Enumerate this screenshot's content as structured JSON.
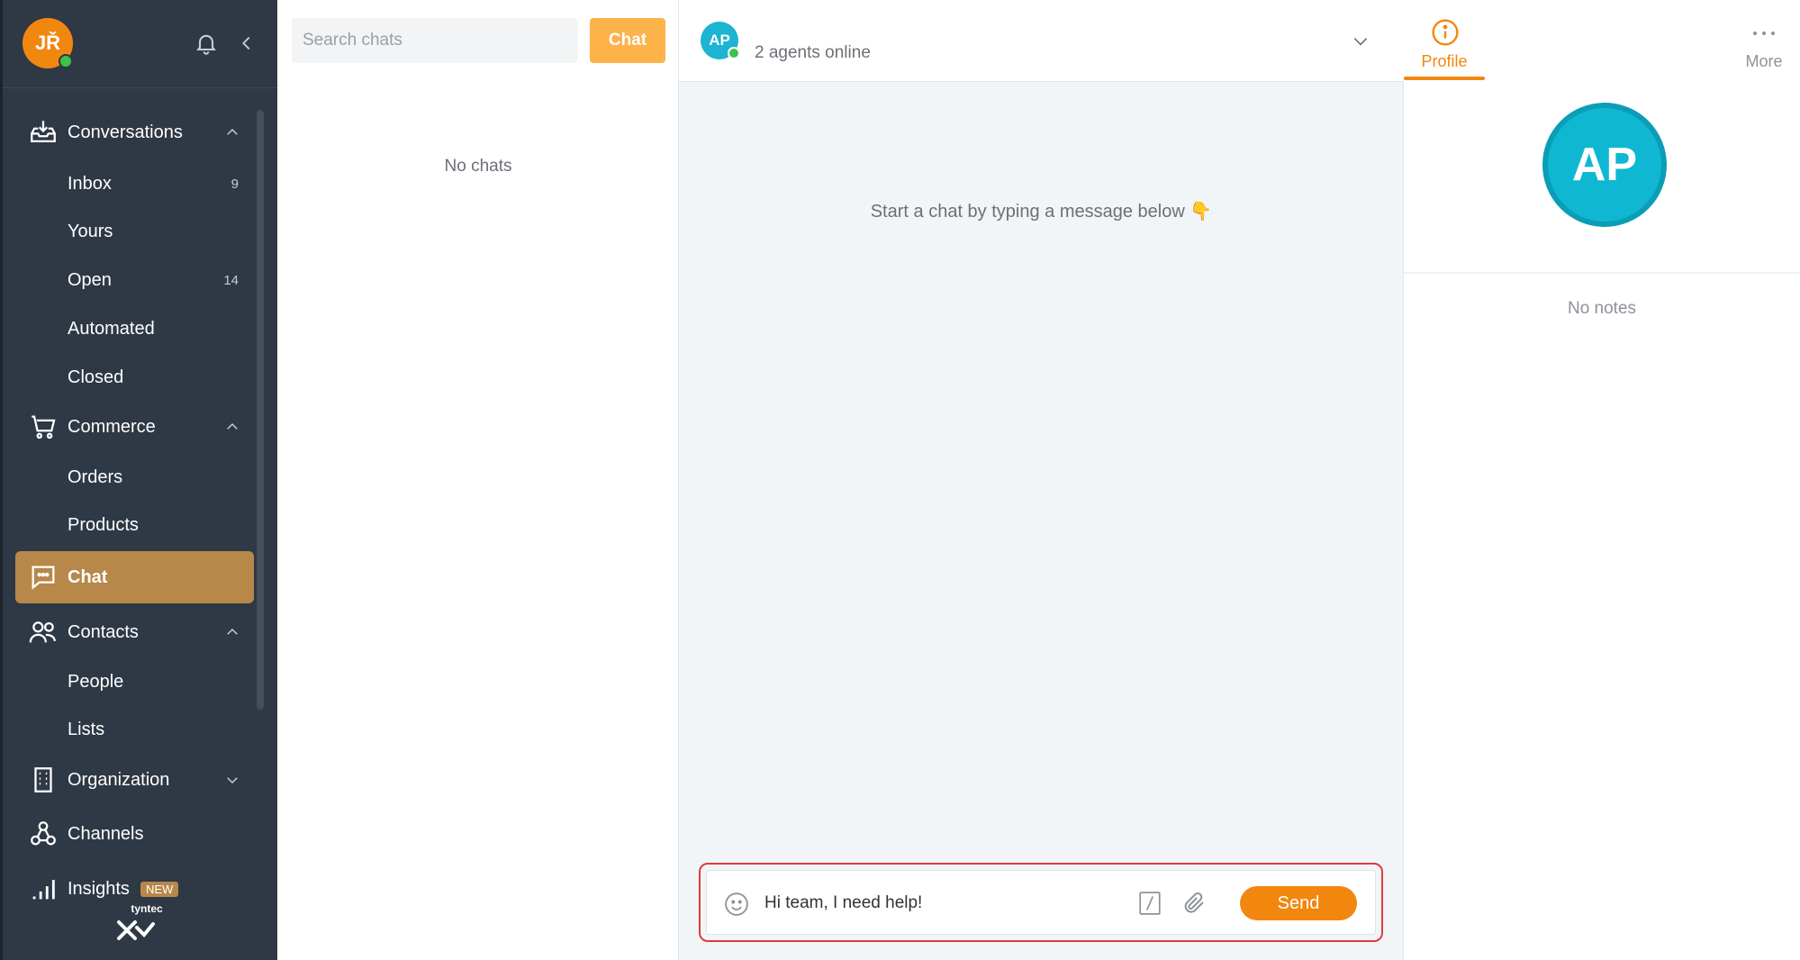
{
  "user": {
    "initials": "JŘ",
    "status_color": "#3ec04b"
  },
  "sidebar": {
    "sections": [
      {
        "label": "Conversations",
        "icon": "inbox-tray-icon",
        "expanded": true,
        "items": [
          {
            "label": "Inbox",
            "count": "9"
          },
          {
            "label": "Yours",
            "count": ""
          },
          {
            "label": "Open",
            "count": "14"
          },
          {
            "label": "Automated",
            "count": ""
          },
          {
            "label": "Closed",
            "count": ""
          }
        ]
      },
      {
        "label": "Commerce",
        "icon": "cart-icon",
        "expanded": true,
        "items": [
          {
            "label": "Orders"
          },
          {
            "label": "Products"
          }
        ]
      },
      {
        "label": "Chat",
        "icon": "chat-bubble-icon",
        "active": true
      },
      {
        "label": "Contacts",
        "icon": "people-icon",
        "expanded": true,
        "items": [
          {
            "label": "People"
          },
          {
            "label": "Lists"
          }
        ]
      },
      {
        "label": "Organization",
        "icon": "building-icon",
        "expanded": false
      },
      {
        "label": "Channels",
        "icon": "channels-icon"
      },
      {
        "label": "Insights",
        "icon": "bar-chart-icon",
        "badge": "NEW"
      }
    ],
    "brand": "tyntec",
    "active_color": "#b7884a"
  },
  "chatlist": {
    "search_placeholder": "Search chats",
    "chat_button": "Chat",
    "empty": "No chats"
  },
  "conversation": {
    "avatar_initials": "AP",
    "agents_online": "2 agents online",
    "start_message": "Start a chat by typing a message below 👇",
    "composer_value": "Hi team, I need help!",
    "send_label": "Send"
  },
  "panel": {
    "tab_profile": "Profile",
    "tab_more": "More",
    "avatar_initials": "AP",
    "empty_notes": "No notes"
  },
  "colors": {
    "accent": "#f2870f",
    "avatar": "#10b7d3",
    "sidebar": "#2f3845"
  }
}
